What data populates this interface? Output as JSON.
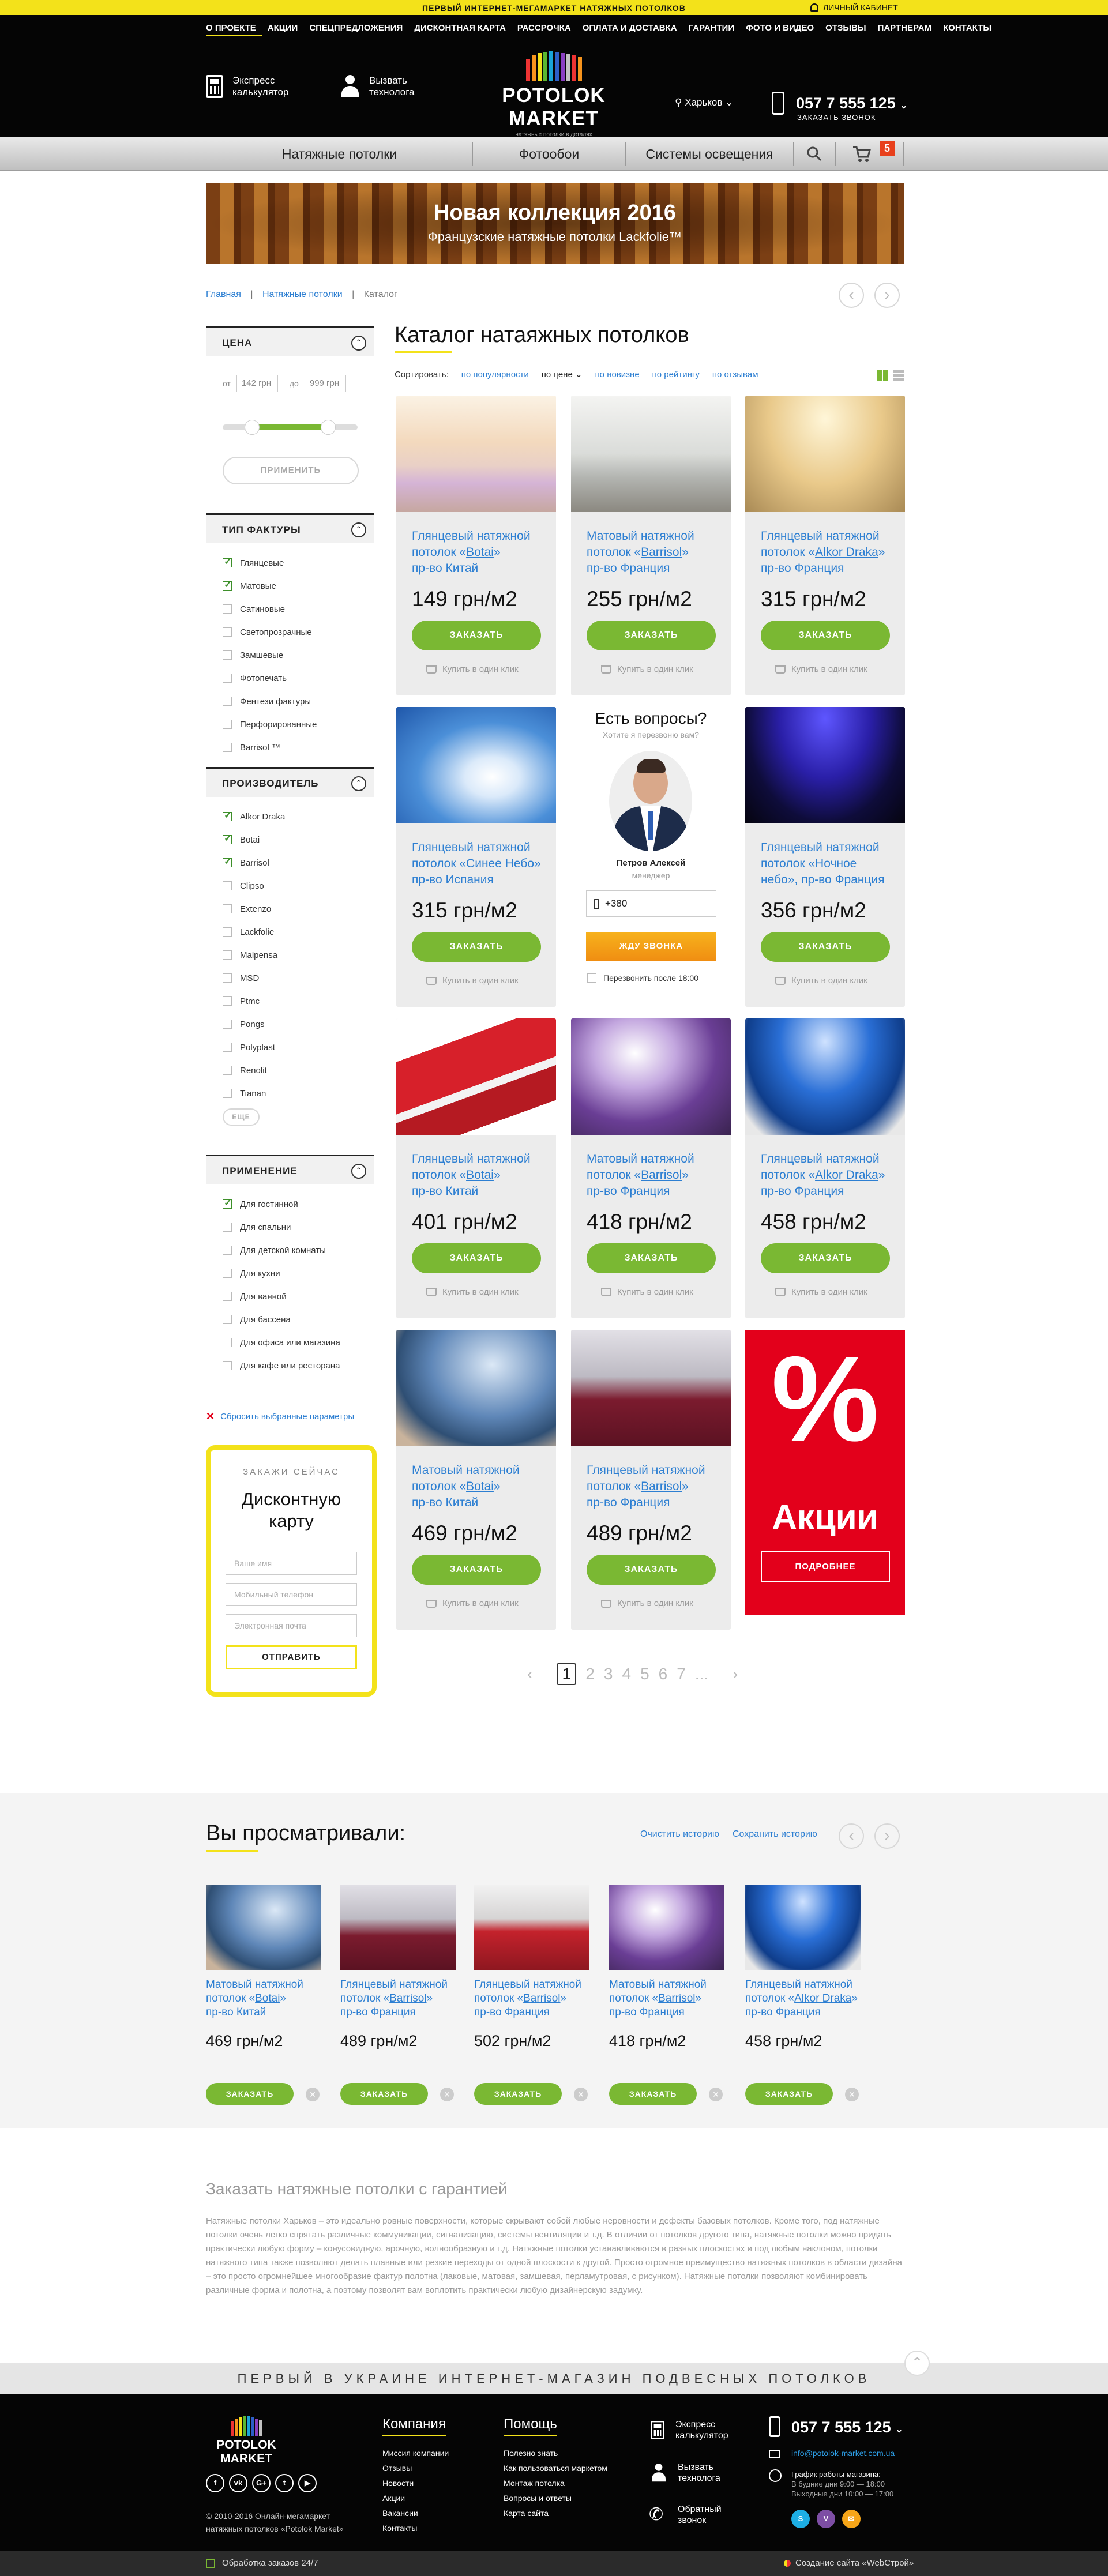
{
  "topbar": {
    "slogan": "ПЕРВЫЙ ИНТЕРНЕТ-МЕГАМАРКЕТ НАТЯЖНЫХ ПОТОЛКОВ",
    "cabinet": "ЛИЧНЫЙ КАБИНЕТ"
  },
  "menu": [
    "О ПРОЕКТЕ",
    "АКЦИИ",
    "СПЕЦПРЕДЛОЖЕНИЯ",
    "ДИСКОНТНАЯ КАРТА",
    "РАССРОЧКА",
    "ОПЛАТА И ДОСТАВКА",
    "ГАРАНТИИ",
    "ФОТО И ВИДЕО",
    "ОТЗЫВЫ",
    "ПАРТНЕРАМ",
    "КОНТАКТЫ"
  ],
  "header": {
    "calc_line1": "Экспресс",
    "calc_line2": "калькулятор",
    "tech_line1": "Вызвать",
    "tech_line2": "технолога",
    "logo_name": "POTOLOK MARKET",
    "logo_sub": "натяжные потолки в деталях",
    "city": "Харьков",
    "phone": "057 7 555 125",
    "callback": "ЗАКАЗАТЬ ЗВОНОК"
  },
  "nav": {
    "items": [
      "Натяжные потолки",
      "Фотообои",
      "Системы освещения"
    ],
    "cart_count": "5"
  },
  "banner": {
    "title": "Новая коллекция 2016",
    "subtitle": "Французские натяжные потолки Lackfolie™"
  },
  "breadcrumbs": {
    "home": "Главная",
    "section": "Натяжные потолки",
    "current": "Каталог"
  },
  "catalog": {
    "title": "Каталог натаяжных потолков",
    "sort_label": "Сортировать:",
    "sort_options": [
      "по популярности",
      "по цене",
      "по новизне",
      "по рейтингу",
      "по отзывам"
    ]
  },
  "filters": {
    "price": {
      "title": "ЦЕНА",
      "from_label": "от",
      "from": "142 грн",
      "to_label": "до",
      "to": "999 грн",
      "apply": "ПРИМЕНИТЬ",
      "range": [
        0.22,
        0.78
      ]
    },
    "texture": {
      "title": "ТИП ФАКТУРЫ",
      "items": [
        "Глянцевые",
        "Матовые",
        "Сатиновые",
        "Светопрозрачные",
        "Замшевые",
        "Фотопечать",
        "Фентези фактуры",
        "Перфорированные",
        "Barrisol ™"
      ],
      "checked": [
        true,
        true,
        false,
        false,
        false,
        false,
        false,
        false,
        false
      ]
    },
    "maker": {
      "title": "ПРОИЗВОДИТЕЛЬ",
      "items": [
        "Alkor Draka",
        "Botai",
        "Barrisol",
        "Clipso",
        "Extenzo",
        "Lackfolie",
        "Malpensa",
        "MSD",
        "Ptmc",
        "Pongs",
        "Polyplast",
        "Renolit",
        "Tianan"
      ],
      "checked": [
        true,
        true,
        true,
        false,
        false,
        false,
        false,
        false,
        false,
        false,
        false,
        false,
        false
      ],
      "more": "ЕЩЕ"
    },
    "usage": {
      "title": "ПРИМЕНЕНИЕ",
      "items": [
        "Для гостинной",
        "Для спальни",
        "Для детской комнаты",
        "Для кухни",
        "Для ванной",
        "Для бассена",
        "Для офиса или магазина",
        "Для кафе или ресторана"
      ],
      "checked": [
        true,
        false,
        false,
        false,
        false,
        false,
        false,
        false
      ]
    },
    "reset": "Сбросить выбранные параметры"
  },
  "promo": {
    "kicker": "ЗАКАЖИ СЕЙЧАС",
    "title1": "Дисконтную",
    "title2": "карту",
    "name_ph": "Ваше имя",
    "phone_ph": "Мобильный телефон",
    "email_ph": "Электронная почта",
    "submit": "ОТПРАВИТЬ"
  },
  "products": [
    {
      "l1": "Глянцевый натяжной",
      "l2a": "потолок «",
      "brand": "Botai",
      "l2b": "»",
      "l3": "пр-во Китай",
      "price": "149 грн/м2"
    },
    {
      "l1": "Матовый натяжной",
      "l2a": "потолок «",
      "brand": "Barrisol",
      "l2b": "»",
      "l3": "пр-во Франция",
      "price": "255 грн/м2"
    },
    {
      "l1": "Глянцевый натяжной",
      "l2a": "потолок «",
      "brand": "Alkor Draka",
      "l2b": "»",
      "l3": "пр-во Франция",
      "price": "315 грн/м2"
    },
    {
      "l1": "Глянцевый натяжной",
      "l2a": "потолок «Синее Небо»",
      "brand": "",
      "l2b": "",
      "l3": "пр-во Испания",
      "price": "315 грн/м2"
    },
    {
      "l1": "Глянцевый натяжной",
      "l2a": "потолок «Ночное",
      "brand": "",
      "l2b": "",
      "l3": "небо», пр-во Франция",
      "price": "356 грн/м2"
    },
    {
      "l1": "Глянцевый натяжной",
      "l2a": "потолок «",
      "brand": "Botai",
      "l2b": "»",
      "l3": "пр-во Китай",
      "price": "401 грн/м2"
    },
    {
      "l1": "Матовый натяжной",
      "l2a": "потолок «",
      "brand": "Barrisol",
      "l2b": "»",
      "l3": "пр-во Франция",
      "price": "418 грн/м2"
    },
    {
      "l1": "Глянцевый натяжной",
      "l2a": "потолок «",
      "brand": "Alkor Draka",
      "l2b": "»",
      "l3": "пр-во Франция",
      "price": "458 грн/м2"
    },
    {
      "l1": "Матовый натяжной",
      "l2a": "потолок «",
      "brand": "Botai",
      "l2b": "»",
      "l3": "пр-во Китай",
      "price": "469 грн/м2"
    },
    {
      "l1": "Глянцевый натяжной",
      "l2a": "потолок «",
      "brand": "Barrisol",
      "l2b": "»",
      "l3": "пр-во Франция",
      "price": "489 грн/м2"
    }
  ],
  "card_actions": {
    "order": "ЗАКАЗАТЬ",
    "oneclick": "Купить в один клик"
  },
  "consult": {
    "title": "Есть вопросы?",
    "subtitle": "Хотите я перезвоню вам?",
    "name": "Петров Алексей",
    "role": "менеджер",
    "phone_value": "+380",
    "button": "ЖДУ ЗВОНКА",
    "later": "Перезвонить после 18:00"
  },
  "sale": {
    "symbol": "%",
    "title": "Акции",
    "button": "ПОДРОБНЕЕ"
  },
  "pagination": {
    "prev": "‹",
    "pages": [
      "1",
      "2",
      "3",
      "4",
      "5",
      "6",
      "7",
      "..."
    ],
    "next": "›"
  },
  "viewed": {
    "title": "Вы просматривали:",
    "clear": "Очистить историю",
    "save": "Сохранить историю",
    "items": [
      {
        "l1": "Матовый натяжной",
        "l2a": "потолок «",
        "brand": "Botai",
        "l2b": "»",
        "l3": "пр-во Китай",
        "price": "469 грн/м2"
      },
      {
        "l1": "Глянцевый натяжной",
        "l2a": "потолок «",
        "brand": "Barrisol",
        "l2b": "»",
        "l3": "пр-во Франция",
        "price": "489 грн/м2"
      },
      {
        "l1": "Глянцевый натяжной",
        "l2a": "потолок «",
        "brand": "Barrisol",
        "l2b": "»",
        "l3": "пр-во Франция",
        "price": "502 грн/м2"
      },
      {
        "l1": "Матовый натяжной",
        "l2a": "потолок «",
        "brand": "Barrisol",
        "l2b": "»",
        "l3": "пр-во Франция",
        "price": "418 грн/м2"
      },
      {
        "l1": "Глянцевый натяжной",
        "l2a": "потолок «",
        "brand": "Alkor Draka",
        "l2b": "»",
        "l3": "пр-во Франция",
        "price": "458 грн/м2"
      }
    ]
  },
  "seo": {
    "title": "Заказать натяжные потолки с гарантией",
    "text": "Натяжные потолки Харьков – это идеально ровные поверхности, которые скрывают собой любые неровности и дефекты базовых потолков. Кроме того, под натяжные потолки очень легко спрятать различные коммуникации, сигнализацию, системы вентиляции и т.д. В отличии от потолков другого типа, натяжные потолки можно придать практически любую форму – конусовидную, арочную, волнообразную и т.д. Натяжные потолки устанавливаются в разных плоскостях и под любым наклоном, потолки натяжного типа также позволяют делать плавные или резкие переходы от одной плоскости к другой. Просто огромное преимущество натяжных потолков в области дизайна – это просто огромнейшее многообразие фактур полотна (лаковые, матовая, замшевая, перламутровая, с рисунком). Натяжные потолки позволяют комбинировать различные форма и полотна, а поэтому позволят вам воплотить практически любую дизайнерскую задумку."
  },
  "footer": {
    "slogan": "ПЕРВЫЙ В УКРАИНЕ ИНТЕРНЕТ-МАГАЗИН ПОДВЕСНЫХ ПОТОЛКОВ",
    "copyright1": "© 2010-2016 Онлайн-мегамаркет",
    "copyright2": "натяжных потолков «Potolok Market»",
    "company_title": "Компания",
    "company": [
      "Миссия компании",
      "Отзывы",
      "Новости",
      "Акции",
      "Вакансии",
      "Контакты"
    ],
    "help_title": "Помощь",
    "help": [
      "Полезно знать",
      "Как пользоваться маркетом",
      "Монтаж потолка",
      "Вопросы и ответы",
      "Карта сайта"
    ],
    "calc1": "Экспресс",
    "calc2": "калькулятор",
    "tech1": "Вызвать",
    "tech2": "технолога",
    "back1": "Обратный",
    "back2": "звонок",
    "phone": "057 7 555 125",
    "email": "info@potolok-market.com.ua",
    "hours_title": "График работы магазина:",
    "hours1": "В будние дни 9:00 — 18:00",
    "hours2": "Выходные дни 10:00 — 17:00",
    "order24": "Обработка заказов 24/7",
    "made": "Создание сайта «WebСтрой»"
  },
  "colors": {
    "accent_yellow": "#f3e21a",
    "green": "#7ab833",
    "link_blue": "#2d7fd2",
    "sale_red": "#e3001b",
    "orange": "#f39a1a"
  }
}
